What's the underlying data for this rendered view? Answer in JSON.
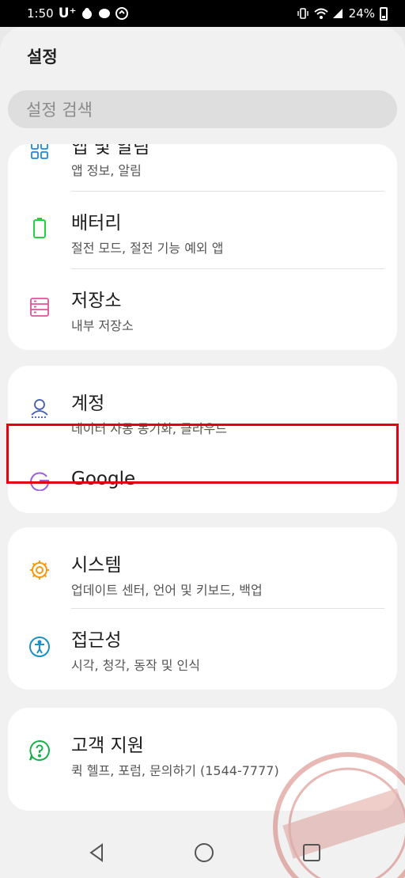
{
  "status_bar": {
    "time": "1:50",
    "carrier": "U⁺",
    "battery": "24%"
  },
  "header": {
    "title": "설정"
  },
  "search": {
    "placeholder": "설정 검색"
  },
  "cards": [
    {
      "rows": [
        {
          "title": "앱 및 알림",
          "subtitle": "앱 정보, 알림",
          "icon": "apps-grid-icon"
        },
        {
          "title": "배터리",
          "subtitle": "절전 모드, 절전 기능 예외 앱",
          "icon": "battery-icon"
        },
        {
          "title": "저장소",
          "subtitle": "내부 저장소",
          "icon": "storage-icon"
        }
      ]
    },
    {
      "rows": [
        {
          "title": "계정",
          "subtitle": "데이터 자동 동기화, 클라우드",
          "icon": "account-icon"
        },
        {
          "title": "Google",
          "icon": "google-icon"
        }
      ]
    },
    {
      "rows": [
        {
          "title": "시스템",
          "subtitle": "업데이트 센터, 언어 및 키보드, 백업",
          "icon": "gear-icon"
        },
        {
          "title": "접근성",
          "subtitle": "시각, 청각, 동작 및 인식",
          "icon": "accessibility-icon"
        }
      ]
    },
    {
      "rows": [
        {
          "title": "고객 지원",
          "subtitle": "퀵 헬프, 포럼, 문의하기 (1544-7777)",
          "icon": "help-icon"
        }
      ]
    }
  ],
  "colors": {
    "accent_blue": "#1e88e5",
    "battery_green": "#2ecc40",
    "storage_pink": "#e0529c",
    "account_blue": "#3f5bb5",
    "google_purple": "#9b5fe0",
    "gear_orange": "#f39c12",
    "access_blue": "#1a8fc8",
    "help_green": "#18b04a",
    "highlight_red": "#e3000f"
  }
}
